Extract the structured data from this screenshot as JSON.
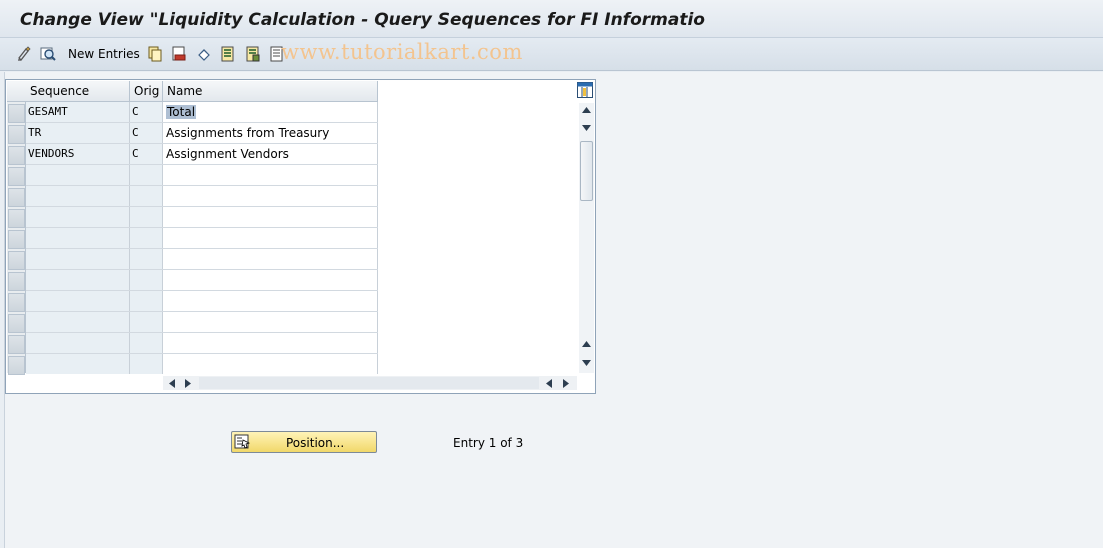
{
  "window": {
    "title": "Change View \"Liquidity Calculation - Query Sequences for FI Informatio"
  },
  "toolbar": {
    "new_entries_label": "New Entries",
    "watermark": "www.tutorialkart.com",
    "icons": [
      "display-change-icon",
      "find-icon",
      "copy-icon",
      "delete-icon",
      "undo-icon",
      "select-all-icon",
      "select-block-icon",
      "deselect-all-icon"
    ]
  },
  "table": {
    "columns": [
      "Sequence",
      "Orig",
      "Name"
    ],
    "rows": [
      {
        "sequence": "GESAMT",
        "orig": "C",
        "name": "Total"
      },
      {
        "sequence": "TR",
        "orig": "C",
        "name": "Assignments from Treasury"
      },
      {
        "sequence": "VENDORS",
        "orig": "C",
        "name": "Assignment Vendors"
      }
    ],
    "empty_rows": 10
  },
  "footer": {
    "position_button": "Position...",
    "entry_text": "Entry 1 of 3"
  },
  "colors": {
    "key_bg": "#e8eff4",
    "button_yellow": "#f1d86a",
    "selection_highlight": "#aebfd3"
  }
}
